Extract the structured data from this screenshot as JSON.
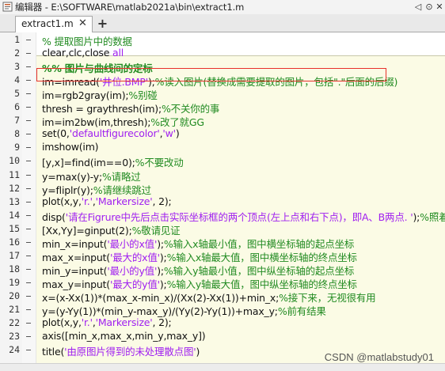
{
  "window": {
    "title": "编辑器 - E:\\SOFTWARE\\matlab2021a\\bin\\extract1.m",
    "buttons": [
      "◁",
      "⊙",
      "✕"
    ]
  },
  "tabs": [
    {
      "label": "extract1.m",
      "close": "✕"
    }
  ],
  "add_tab": "+",
  "lines": [
    {
      "n": "1",
      "parts": [
        {
          "t": "% 提取图片中的数据",
          "c": "c"
        }
      ]
    },
    {
      "n": "2",
      "parts": [
        {
          "t": "clear,clc,close ",
          "c": ""
        },
        {
          "t": "all",
          "c": "s"
        }
      ]
    },
    {
      "n": "3",
      "parts": [
        {
          "t": "%% 图片与曲线间的定标",
          "c": "c cellhead"
        }
      ]
    },
    {
      "n": "4",
      "parts": [
        {
          "t": "im=imread(",
          "c": ""
        },
        {
          "t": "'井位.BMP'",
          "c": "s"
        },
        {
          "t": ");",
          "c": ""
        },
        {
          "t": "%读入图片(替换成需要提取的图片，包括\".\"后面的后缀)",
          "c": "c"
        }
      ]
    },
    {
      "n": "5",
      "parts": [
        {
          "t": "im=rgb2gray(im);",
          "c": ""
        },
        {
          "t": "%别碰",
          "c": "c"
        }
      ]
    },
    {
      "n": "6",
      "parts": [
        {
          "t": "thresh = graythresh(im);",
          "c": ""
        },
        {
          "t": "%不关你的事",
          "c": "c"
        }
      ]
    },
    {
      "n": "7",
      "parts": [
        {
          "t": "im=im2bw(im,thresh);",
          "c": ""
        },
        {
          "t": "%改了就GG",
          "c": "c"
        }
      ]
    },
    {
      "n": "8",
      "parts": [
        {
          "t": "set(0,",
          "c": ""
        },
        {
          "t": "'defaultfigurecolor'",
          "c": "s"
        },
        {
          "t": ",",
          "c": ""
        },
        {
          "t": "'w'",
          "c": "s"
        },
        {
          "t": ")",
          "c": ""
        }
      ]
    },
    {
      "n": "9",
      "parts": [
        {
          "t": "imshow(im)",
          "c": ""
        }
      ]
    },
    {
      "n": "10",
      "parts": [
        {
          "t": "[y,x]=find(im==0);",
          "c": ""
        },
        {
          "t": "%不要改动",
          "c": "c"
        }
      ]
    },
    {
      "n": "11",
      "parts": [
        {
          "t": "y=max(y)-y;",
          "c": ""
        },
        {
          "t": "%请略过",
          "c": "c"
        }
      ]
    },
    {
      "n": "12",
      "parts": [
        {
          "t": "y=fliplr(y);",
          "c": ""
        },
        {
          "t": "%请继续跳过",
          "c": "c"
        }
      ]
    },
    {
      "n": "13",
      "parts": [
        {
          "t": "plot(x,y,",
          "c": ""
        },
        {
          "t": "'r.'",
          "c": "s"
        },
        {
          "t": ",",
          "c": ""
        },
        {
          "t": "'Markersize'",
          "c": "s"
        },
        {
          "t": ", 2);",
          "c": ""
        }
      ]
    },
    {
      "n": "14",
      "parts": [
        {
          "t": "disp(",
          "c": ""
        },
        {
          "t": "'请在Figrure中先后点击实际坐标框的两个顶点(左上点和右下点)，即A、B两点. '",
          "c": "s"
        },
        {
          "t": ");",
          "c": ""
        },
        {
          "t": "%照着说(",
          "c": "c"
        }
      ]
    },
    {
      "n": "15",
      "parts": [
        {
          "t": "[Xx,Yy]=ginput(2);",
          "c": ""
        },
        {
          "t": "%敬请见证",
          "c": "c"
        }
      ]
    },
    {
      "n": "16",
      "parts": [
        {
          "t": "min_x=input(",
          "c": ""
        },
        {
          "t": "'最小的x值'",
          "c": "s"
        },
        {
          "t": ");",
          "c": ""
        },
        {
          "t": "%输入x轴最小值，图中横坐标轴的起点坐标",
          "c": "c"
        }
      ]
    },
    {
      "n": "17",
      "parts": [
        {
          "t": "max_x=input(",
          "c": ""
        },
        {
          "t": "'最大的x值'",
          "c": "s"
        },
        {
          "t": ");",
          "c": ""
        },
        {
          "t": "%输入x轴最大值，图中横坐标轴的终点坐标",
          "c": "c"
        }
      ]
    },
    {
      "n": "18",
      "parts": [
        {
          "t": "min_y=input(",
          "c": ""
        },
        {
          "t": "'最小的y值'",
          "c": "s"
        },
        {
          "t": ");",
          "c": ""
        },
        {
          "t": "%输入y轴最小值，图中纵坐标轴的起点坐标",
          "c": "c"
        }
      ]
    },
    {
      "n": "19",
      "parts": [
        {
          "t": "max_y=input(",
          "c": ""
        },
        {
          "t": "'最大的y值'",
          "c": "s"
        },
        {
          "t": ");",
          "c": ""
        },
        {
          "t": "%输入y轴最大值，图中纵坐标轴的终点坐标",
          "c": "c"
        }
      ]
    },
    {
      "n": "20",
      "parts": [
        {
          "t": "x=(x-Xx(1))*(max_x-min_x)/(Xx(2)-Xx(1))+min_x;",
          "c": ""
        },
        {
          "t": "%接下来，无视很有用",
          "c": "c"
        }
      ]
    },
    {
      "n": "21",
      "parts": [
        {
          "t": "y=(y-Yy(1))*(min_y-max_y)/(Yy(2)-Yy(1))+max_y;",
          "c": ""
        },
        {
          "t": "%前有结果",
          "c": "c"
        }
      ]
    },
    {
      "n": "22",
      "parts": [
        {
          "t": "plot(x,y,",
          "c": ""
        },
        {
          "t": "'r.'",
          "c": "s"
        },
        {
          "t": ",",
          "c": ""
        },
        {
          "t": "'Markersize'",
          "c": "s"
        },
        {
          "t": ", 2);",
          "c": ""
        }
      ]
    },
    {
      "n": "23",
      "parts": [
        {
          "t": "axis([min_x,max_x,min_y,max_y])",
          "c": ""
        }
      ]
    },
    {
      "n": "24",
      "parts": [
        {
          "t": "title(",
          "c": ""
        },
        {
          "t": "'由原图片得到的未处理散点图'",
          "c": "s"
        },
        {
          "t": ")",
          "c": ""
        }
      ]
    }
  ],
  "watermark": "CSDN @matlabstudy01",
  "colors": {
    "comment": "#228b22",
    "string": "#a020f0",
    "cell_bg": "#fbfbe5",
    "highlight_border": "#e8312c"
  }
}
